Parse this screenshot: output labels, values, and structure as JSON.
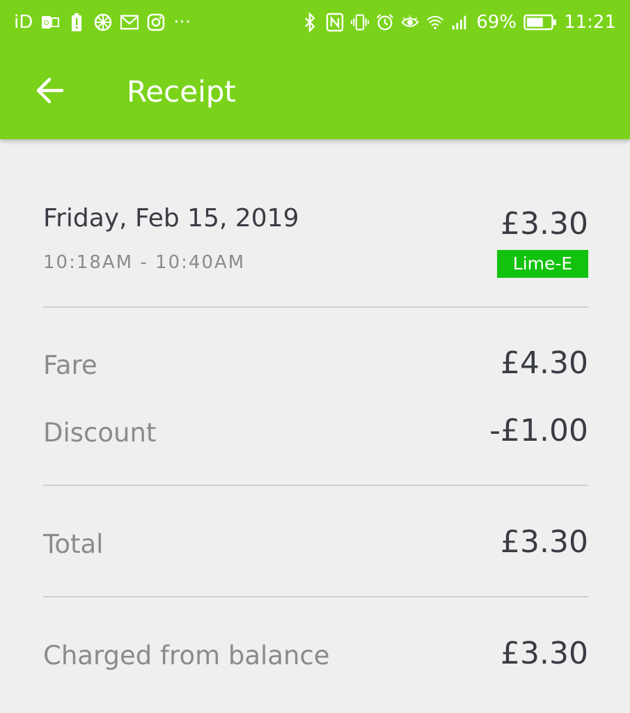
{
  "status_bar": {
    "left_text": "iD",
    "left_icons": [
      "outlook-icon",
      "battery-alert-icon",
      "citrus-icon",
      "mail-icon",
      "instagram-icon"
    ],
    "more": "···",
    "right_icons": [
      "bluetooth-icon",
      "nfc-icon",
      "vibrate-icon",
      "alarm-icon",
      "eye-icon",
      "wifi-icon",
      "signal-icon"
    ],
    "battery_percent": "69%",
    "battery_level": 0.69,
    "time": "11:21"
  },
  "toolbar": {
    "title": "Receipt",
    "back_icon": "arrow-back-icon",
    "color": "#7ad31a"
  },
  "trip": {
    "date": "Friday, Feb 15, 2019",
    "time_range": "10:18AM - 10:40AM",
    "amount": "£3.30",
    "vehicle": "Lime-E",
    "vehicle_color": "#12c20e"
  },
  "breakdown": {
    "fare_label": "Fare",
    "fare_value": "£4.30",
    "discount_label": "Discount",
    "discount_value": "-£1.00"
  },
  "total": {
    "label": "Total",
    "value": "£3.30"
  },
  "charged": {
    "label": "Charged from balance",
    "value": "£3.30"
  }
}
